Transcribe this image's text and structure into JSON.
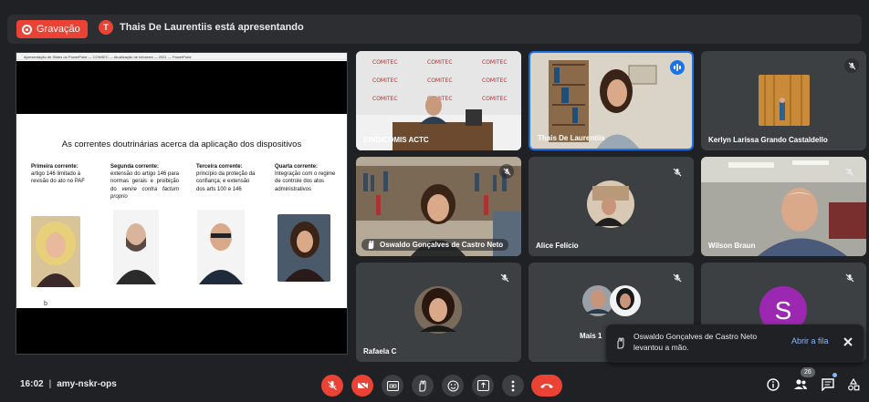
{
  "top_bar": {
    "recording_label": "Gravação",
    "presenter_initial": "T",
    "presenter_text": "Thais De Laurentiis está apresentando"
  },
  "presentation": {
    "window_title": "Apresentação de Slides do PowerPoint — CONSEC — Atualização de Informes — 2021 — PowerPoint",
    "slide_title": "As correntes doutrinárias acerca da aplicação dos dispositivos",
    "columns": [
      {
        "heading": "Primeira corrente:",
        "text": "artigo 146 limitado à revisão do ato no PAF"
      },
      {
        "heading": "Segunda corrente:",
        "text": "extensão do artigo 146 para normas gerais e proibição do",
        "italic": "venire contra factum proprio"
      },
      {
        "heading": "Terceira corrente:",
        "text": "princípio da proteção da confiança; e extensão dos arts 100 e 146"
      },
      {
        "heading": "Quarta corrente:",
        "text": "Integração com o regime de controle dos atos administrativos"
      }
    ],
    "footer_mark": "b"
  },
  "participants": [
    {
      "name": "SINDICOMIS ACTC",
      "muted": false,
      "speaking": false
    },
    {
      "name": "Thais De Laurentiis",
      "muted": false,
      "speaking": true
    },
    {
      "name": "Kerlyn Larissa Grando Castaldello",
      "muted": true,
      "speaking": false
    },
    {
      "name": "Oswaldo Gonçalves de Castro Neto",
      "muted": true,
      "speaking": false,
      "hand_raised": true
    },
    {
      "name": "Alice Felício",
      "muted": true,
      "speaking": false
    },
    {
      "name": "Wilson Braun",
      "muted": true,
      "speaking": false
    },
    {
      "name": "Rafaela C",
      "muted": true,
      "speaking": false
    },
    {
      "name": "Mais 1",
      "muted": true,
      "speaking": false
    },
    {
      "name": "S",
      "muted": true,
      "speaking": false,
      "avatar_color": "#9c27b0"
    }
  ],
  "backdrop_brand": "COMITEC",
  "toast": {
    "message": "Oswaldo Gonçalves de Castro Neto levantou a mão.",
    "action": "Abrir a fila"
  },
  "bottom_bar": {
    "time": "16:02",
    "separator": "|",
    "meeting_code": "amy-nskr-ops",
    "participant_count": "26"
  },
  "colors": {
    "background": "#202124",
    "tile": "#3c4043",
    "danger": "#ea4335",
    "accent_blue": "#1a73e8",
    "link": "#8ab4f8"
  },
  "icons": [
    "record-icon",
    "mic-off-icon",
    "camera-off-icon",
    "captions-icon",
    "raise-hand-icon",
    "emoji-icon",
    "present-icon",
    "more-options-icon",
    "end-call-icon",
    "info-icon",
    "people-icon",
    "chat-icon",
    "activities-icon",
    "close-icon"
  ]
}
